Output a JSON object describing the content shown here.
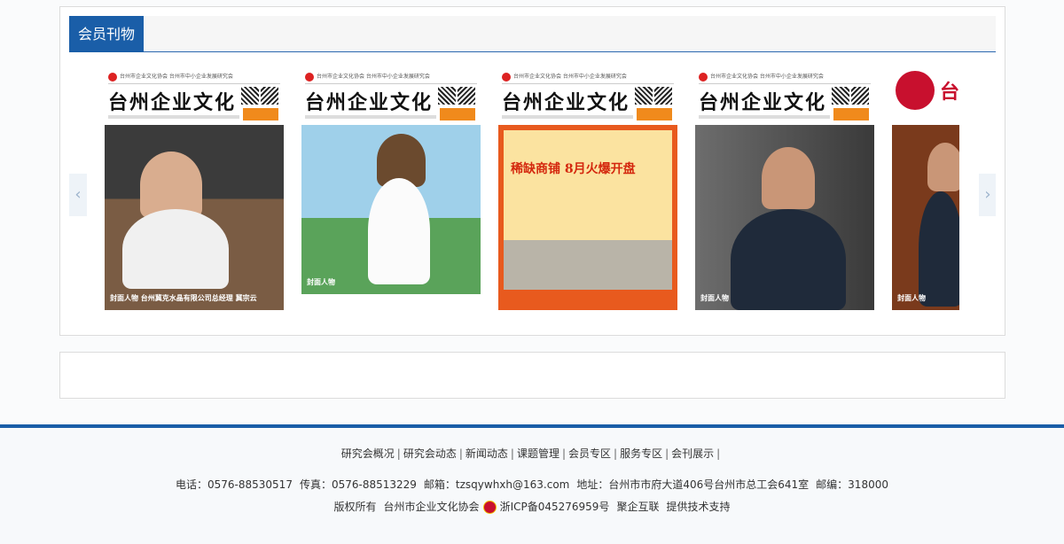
{
  "section": {
    "title": "会员刊物"
  },
  "carousel": {
    "prev_icon": "chevron-left-icon",
    "next_icon": "chevron-right-icon",
    "prev_glyph": "‹",
    "next_glyph": "›",
    "magazines": [
      {
        "org": "台州市企业文化协会  台州市中小企业发展研究会",
        "title": "台州企业文化",
        "caption": "封面人物  台州冀克水晶有限公司总经理 冀宗云",
        "cover_color": "#8a6a4c",
        "bg_top": "#3b3b3b"
      },
      {
        "org": "台州市企业文化协会  台州市中小企业发展研究会",
        "title": "台州企业文化",
        "caption": "封面人物",
        "cover_color": "#6fb0d9",
        "bg_top": "#9fd0ea"
      },
      {
        "org": "台州市企业文化协会  台州市中小企业发展研究会",
        "title": "台州企业文化",
        "caption": "稀缺商铺 8月火爆开盘",
        "cover_color": "#e85a1e",
        "bg_top": "#fbe3a0"
      },
      {
        "org": "台州市企业文化协会  台州市中小企业发展研究会",
        "title": "台州企业文化",
        "caption": "封面人物",
        "cover_color": "#4a4a4a",
        "bg_top": "#6d6d6d"
      },
      {
        "org": "",
        "title": "台",
        "caption": "封面人物",
        "cover_color": "#6a2a1a",
        "bg_top": "#7a3a1c"
      }
    ]
  },
  "footer": {
    "nav": [
      "研究会概况",
      "研究会动态",
      "新闻动态",
      "课题管理",
      "会员专区",
      "服务专区",
      "会刊展示"
    ],
    "phone": "电话：0576-88530517",
    "fax": "传真：0576-88513229",
    "email": "邮箱：tzsqywhxh@163.com",
    "address": "地址：台州市市府大道406号台州市总工会641室",
    "postcode": "邮编：318000",
    "copyright": "版权所有",
    "org": "台州市企业文化协会",
    "icp": "浙ICP备045276959号",
    "tech": "聚企互联",
    "support": "提供技术支持",
    "colors": {
      "brand": "#1a5ea8"
    }
  }
}
